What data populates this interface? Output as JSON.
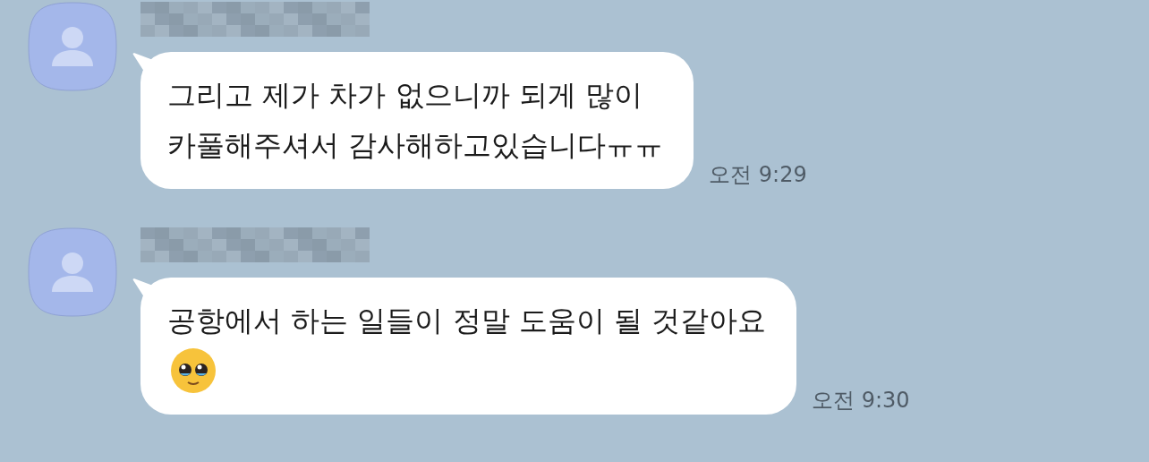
{
  "messages": [
    {
      "lines": [
        "그리고 제가 차가 없으니까 되게 많이",
        "카풀해주셔서 감사해하고있습니다ㅠㅠ"
      ],
      "emoji": false,
      "time": "오전 9:29"
    },
    {
      "lines": [
        "공항에서 하는 일들이 정말 도움이 될 것같아요"
      ],
      "emoji": true,
      "time": "오전 9:30"
    }
  ]
}
